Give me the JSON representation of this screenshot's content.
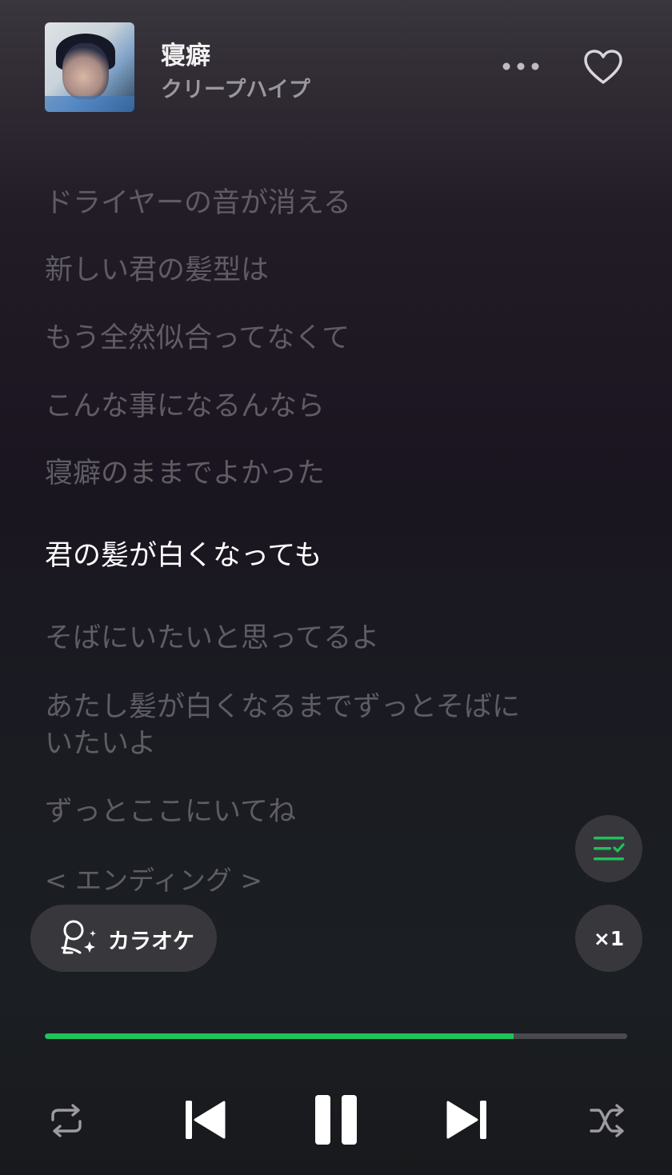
{
  "header": {
    "title": "寝癖",
    "artist": "クリープハイプ"
  },
  "lyrics": [
    {
      "text": "ドライヤーの音が消える",
      "active": false
    },
    {
      "text": "新しい君の髪型は",
      "active": false
    },
    {
      "text": "もう全然似合ってなくて",
      "active": false
    },
    {
      "text": "こんな事になるんなら",
      "active": false
    },
    {
      "text": "寝癖のままでよかった",
      "active": false
    },
    {
      "text": "君の髪が白くなっても",
      "active": true
    },
    {
      "text": "そばにいたいと思ってるよ",
      "active": false
    },
    {
      "text": "あたし髪が白くなるまでずっとそばにいたいよ",
      "active": false
    },
    {
      "text": "ずっとここにいてね",
      "active": false
    },
    {
      "text": "< エンディング >",
      "active": false
    }
  ],
  "karaoke": {
    "label": "カラオケ"
  },
  "speed": {
    "label": "×1"
  },
  "playback": {
    "progress": 0.805,
    "state": "playing"
  },
  "colors": {
    "accent": "#1fc15b",
    "inactive_lyric": "#5f5c63",
    "active_lyric": "#ffffff"
  },
  "icons": {
    "more": "more-dots-icon",
    "like": "heart-outline-icon",
    "queue": "queue-check-icon",
    "karaoke": "karaoke-mic-icon",
    "repeat": "repeat-icon",
    "previous": "skip-previous-icon",
    "pause": "pause-icon",
    "next": "skip-next-icon",
    "shuffle": "shuffle-icon"
  }
}
